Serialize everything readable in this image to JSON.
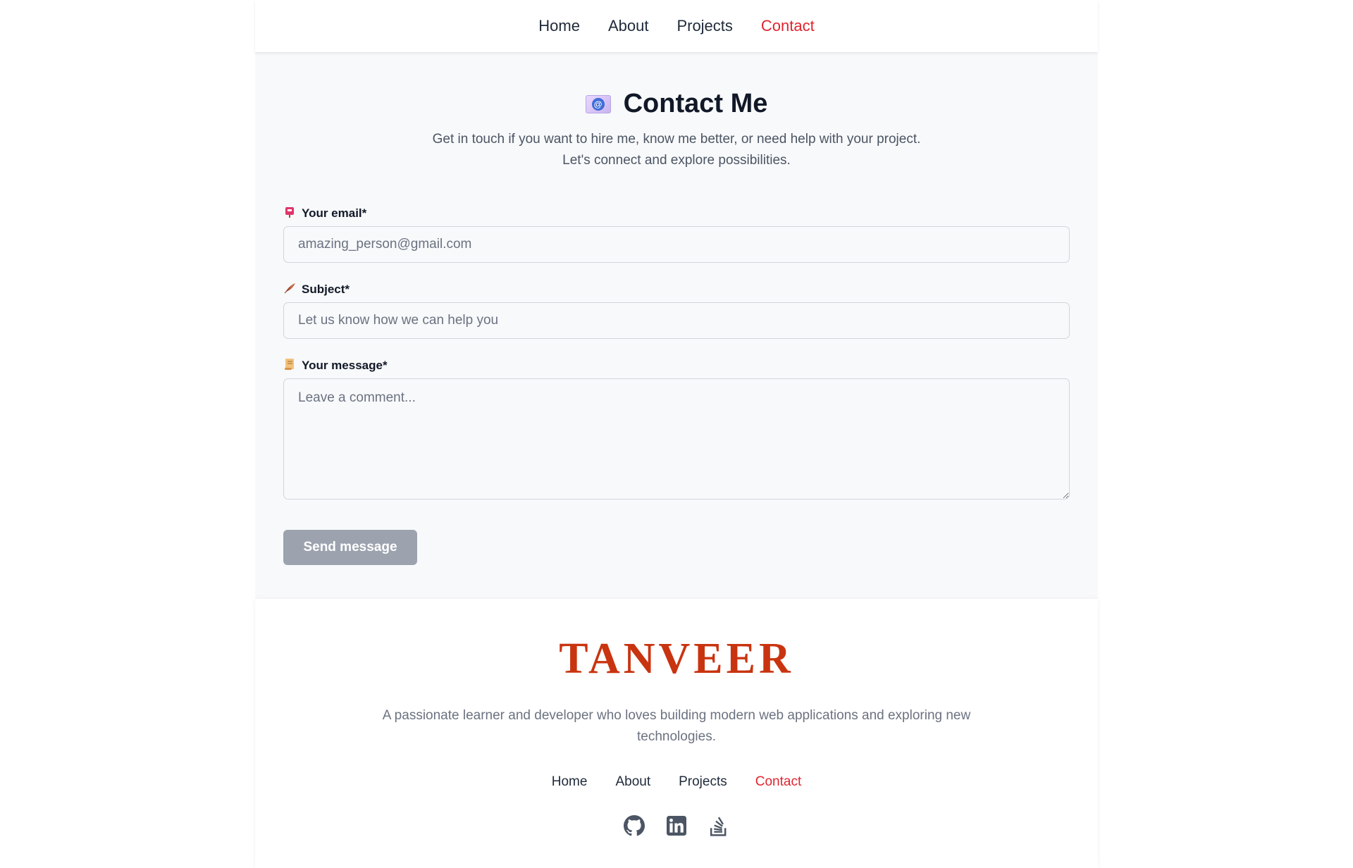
{
  "nav": {
    "items": [
      {
        "label": "Home"
      },
      {
        "label": "About"
      },
      {
        "label": "Projects"
      },
      {
        "label": "Contact"
      }
    ],
    "active": "Contact"
  },
  "contact": {
    "title": "Contact Me",
    "title_icon": "email-icon",
    "intro_line1": "Get in touch if you want to hire me, know me better, or need help with your project.",
    "intro_line2": "Let's connect and explore possibilities.",
    "email": {
      "label": "Your email*",
      "icon": "mailbox-icon",
      "placeholder": "amazing_person@gmail.com",
      "value": ""
    },
    "subject": {
      "label": "Subject*",
      "icon": "feather-icon",
      "placeholder": "Let us know how we can help you",
      "value": ""
    },
    "message": {
      "label": "Your message*",
      "icon": "scroll-icon",
      "placeholder": "Leave a comment...",
      "value": ""
    },
    "send_label": "Send message"
  },
  "footer": {
    "brand": "TANVEER",
    "tagline": "A passionate learner and developer who loves building modern web applications and exploring new technologies.",
    "nav": [
      {
        "label": "Home"
      },
      {
        "label": "About"
      },
      {
        "label": "Projects"
      },
      {
        "label": "Contact"
      }
    ],
    "social": [
      "github-icon",
      "linkedin-icon",
      "stackoverflow-icon"
    ]
  },
  "colors": {
    "accent": "#e0252f",
    "brand": "#c93410",
    "button_disabled": "#9ca3af"
  }
}
